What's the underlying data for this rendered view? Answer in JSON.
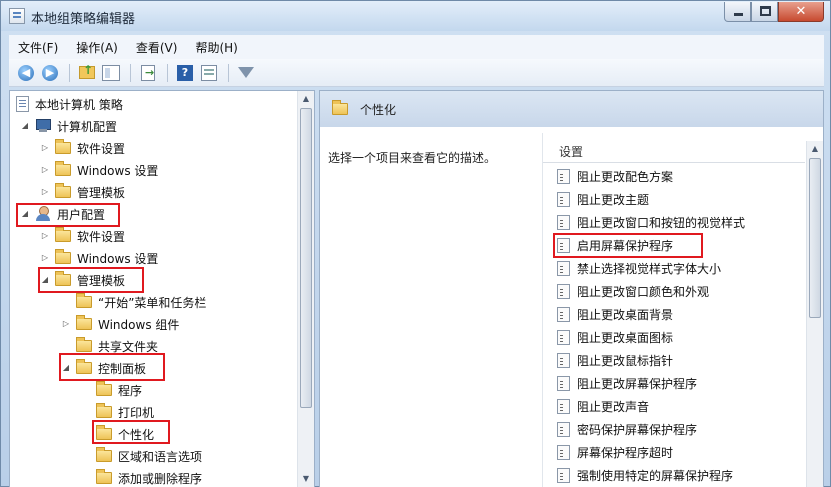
{
  "window": {
    "title": "本地组策略编辑器",
    "close_glyph": "✕"
  },
  "menu": [
    "文件(F)",
    "操作(A)",
    "查看(V)",
    "帮助(H)"
  ],
  "toolbar": {
    "back_glyph": "◀",
    "forward_glyph": "▶",
    "help_glyph": "?"
  },
  "tree": {
    "items": [
      {
        "label": "本地计算机 策略",
        "icon": "document-icon",
        "expander": ""
      },
      {
        "label": "计算机配置",
        "icon": "computer-icon",
        "expander": "◢"
      },
      {
        "label": "软件设置",
        "icon": "folder-icon",
        "expander": "▷"
      },
      {
        "label": "Windows 设置",
        "icon": "folder-icon",
        "expander": "▷"
      },
      {
        "label": "管理模板",
        "icon": "folder-icon",
        "expander": "▷"
      },
      {
        "label": "用户配置",
        "icon": "user-icon",
        "expander": "◢"
      },
      {
        "label": "软件设置",
        "icon": "folder-icon",
        "expander": "▷"
      },
      {
        "label": "Windows 设置",
        "icon": "folder-icon",
        "expander": "▷"
      },
      {
        "label": "管理模板",
        "icon": "folder-icon",
        "expander": "◢"
      },
      {
        "label": "“开始”菜单和任务栏",
        "icon": "folder-icon",
        "expander": ""
      },
      {
        "label": "Windows 组件",
        "icon": "folder-icon",
        "expander": "▷"
      },
      {
        "label": "共享文件夹",
        "icon": "folder-icon",
        "expander": ""
      },
      {
        "label": "控制面板",
        "icon": "folder-icon",
        "expander": "◢"
      },
      {
        "label": "程序",
        "icon": "folder-icon",
        "expander": ""
      },
      {
        "label": "打印机",
        "icon": "folder-icon",
        "expander": ""
      },
      {
        "label": "个性化",
        "icon": "folder-icon",
        "expander": ""
      },
      {
        "label": "区域和语言选项",
        "icon": "folder-icon",
        "expander": ""
      },
      {
        "label": "添加或删除程序",
        "icon": "folder-icon",
        "expander": ""
      }
    ],
    "scroll_up": "▲",
    "scroll_down": "▼"
  },
  "right": {
    "header_title": "个性化",
    "description": "选择一个项目来查看它的描述。",
    "settings_header": "设置",
    "settings": [
      "阻止更改配色方案",
      "阻止更改主题",
      "阻止更改窗口和按钮的视觉样式",
      "启用屏幕保护程序",
      "禁止选择视觉样式字体大小",
      "阻止更改窗口颜色和外观",
      "阻止更改桌面背景",
      "阻止更改桌面图标",
      "阻止更改鼠标指针",
      "阻止更改屏幕保护程序",
      "阻止更改声音",
      "密码保护屏幕保护程序",
      "屏幕保护程序超时",
      "强制使用特定的屏幕保护程序"
    ]
  },
  "colors": {
    "highlight_box": "#e0191f",
    "header_gradient_top": "#dbe6f3",
    "folder_yellow": "#eec357"
  }
}
